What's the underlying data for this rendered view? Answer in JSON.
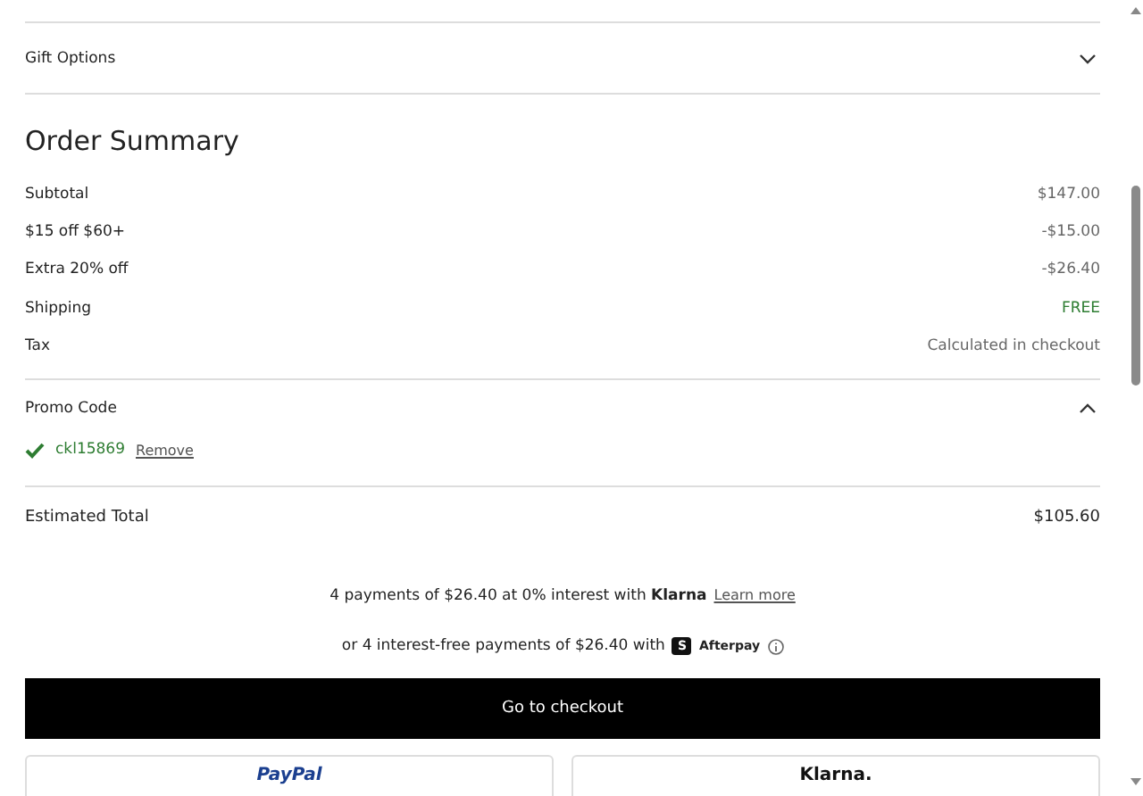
{
  "gift_options": {
    "label": "Gift Options",
    "expanded": false
  },
  "order_summary": {
    "title": "Order Summary",
    "rows": [
      {
        "label": "Subtotal",
        "value": "$147.00",
        "kind": "plain"
      },
      {
        "label": "$15 off $60+",
        "value": "-$15.00",
        "kind": "plain"
      },
      {
        "label": "Extra 20% off",
        "value": "-$26.40",
        "kind": "plain"
      },
      {
        "label": "Shipping",
        "value": "FREE",
        "kind": "free"
      },
      {
        "label": "Tax",
        "value": "Calculated in checkout",
        "kind": "plain"
      }
    ]
  },
  "promo_code": {
    "label": "Promo Code",
    "expanded": true,
    "applied_code": "ckl15869",
    "remove_link": "Remove"
  },
  "estimated_total": {
    "label": "Estimated Total",
    "value": "$105.60"
  },
  "klarna_line": {
    "text": "4 payments of $26.40 at 0% interest with **Klarna**",
    "link": "Learn more"
  },
  "afterpay_line": {
    "text": "or 4 interest-free payments of $26.40 with",
    "logo_letter": "S",
    "brand": "Afterpay"
  },
  "checkout_button": "Go to checkout",
  "wallet_buttons": [
    {
      "label": "PayPal",
      "kind": "paypal"
    },
    {
      "label": "Klarna.",
      "kind": "klarna"
    }
  ]
}
